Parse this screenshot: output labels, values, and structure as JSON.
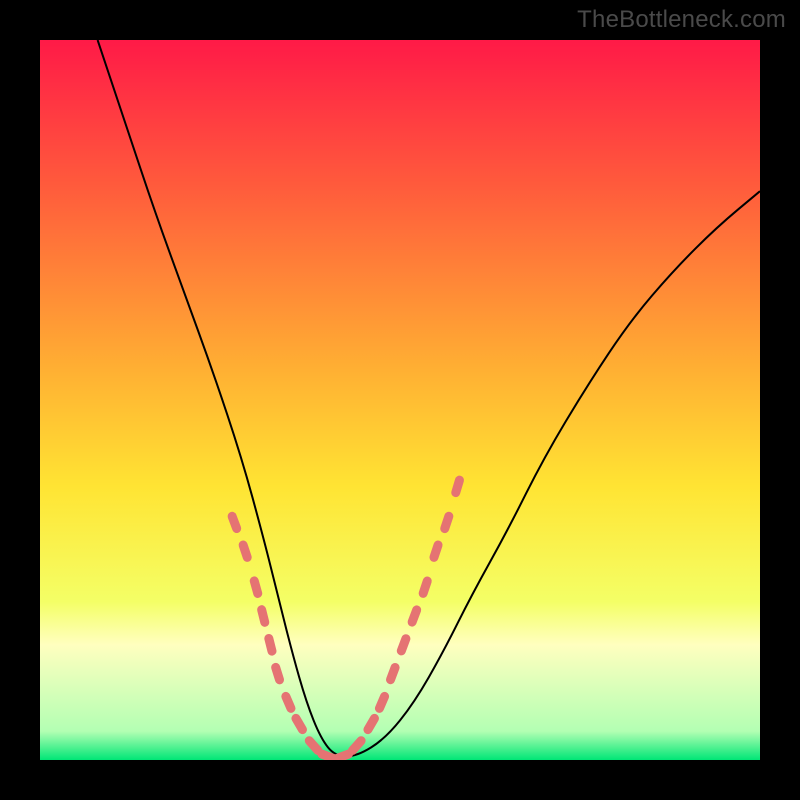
{
  "watermark": "TheBottleneck.com",
  "chart_data": {
    "type": "line",
    "title": "",
    "xlabel": "",
    "ylabel": "",
    "xlim": [
      0,
      100
    ],
    "ylim": [
      0,
      100
    ],
    "grid": false,
    "legend": false,
    "background_gradient": {
      "stops": [
        {
          "offset": 0.0,
          "color": "#ff1a47"
        },
        {
          "offset": 0.2,
          "color": "#ff5a3c"
        },
        {
          "offset": 0.45,
          "color": "#ffad33"
        },
        {
          "offset": 0.62,
          "color": "#ffe433"
        },
        {
          "offset": 0.78,
          "color": "#f4ff66"
        },
        {
          "offset": 0.84,
          "color": "#ffffbf"
        },
        {
          "offset": 0.96,
          "color": "#b3ffb3"
        },
        {
          "offset": 1.0,
          "color": "#00e676"
        }
      ]
    },
    "series": [
      {
        "name": "bottleneck-curve",
        "color": "#000000",
        "width": 2,
        "x": [
          8,
          12,
          16,
          20,
          24,
          28,
          31,
          33,
          35,
          37,
          39,
          41,
          44,
          48,
          52,
          56,
          60,
          65,
          70,
          76,
          82,
          88,
          94,
          100
        ],
        "y": [
          100,
          88,
          76,
          65,
          54,
          42,
          31,
          23,
          15,
          8,
          3,
          0.5,
          0.5,
          3,
          8,
          15,
          23,
          32,
          42,
          52,
          61,
          68,
          74,
          79
        ]
      },
      {
        "name": "optimal-band-markers",
        "color": "#e57373",
        "marker_size": 9,
        "x": [
          27,
          28.5,
          30,
          31,
          32,
          33,
          34.5,
          36,
          38,
          40,
          42,
          44,
          46,
          47.5,
          49,
          50.5,
          52,
          53.5,
          55,
          56.5,
          58
        ],
        "y": [
          33,
          29,
          24,
          20,
          16,
          12,
          8,
          5,
          2,
          0.5,
          0.5,
          2,
          5,
          8,
          12,
          16,
          20,
          24,
          29,
          33,
          38
        ]
      }
    ],
    "annotations": []
  }
}
